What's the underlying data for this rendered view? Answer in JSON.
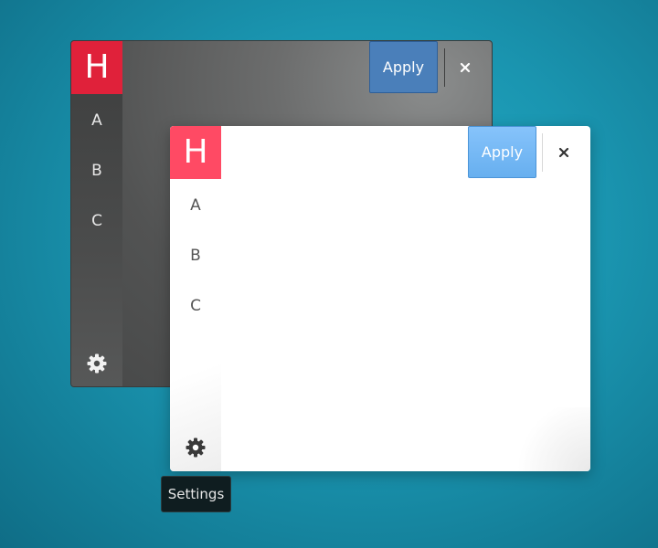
{
  "windows": {
    "dark": {
      "logo_letter": "H",
      "nav_items": [
        {
          "label": "A"
        },
        {
          "label": "B"
        },
        {
          "label": "C"
        }
      ],
      "apply_label": "Apply",
      "close_label": "×",
      "settings_icon": "gear-icon"
    },
    "light": {
      "logo_letter": "H",
      "nav_items": [
        {
          "label": "A"
        },
        {
          "label": "B"
        },
        {
          "label": "C"
        }
      ],
      "apply_label": "Apply",
      "close_label": "×",
      "settings_icon": "gear-icon"
    }
  },
  "tooltip": {
    "text": "Settings"
  },
  "colors": {
    "desktop": "#1a95b0",
    "dark_logo": "#e0213a",
    "light_logo": "#ff4a64",
    "dark_apply": "#4a7fba",
    "light_apply": "#6cb4f2"
  }
}
